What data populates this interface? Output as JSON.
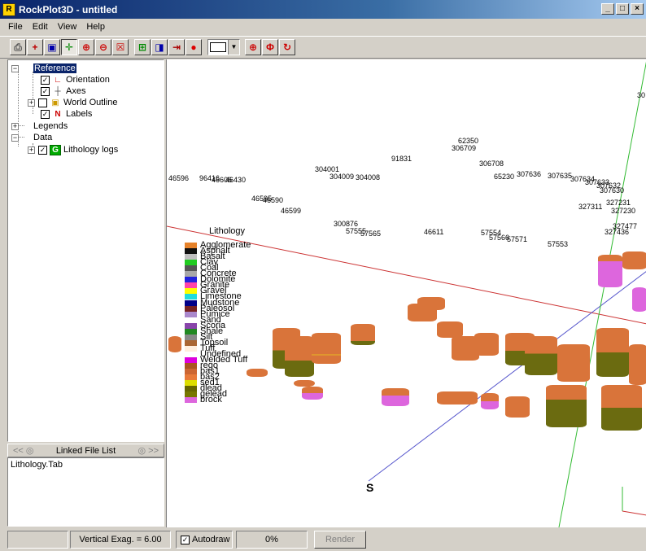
{
  "window": {
    "title": "RockPlot3D - untitled",
    "app_icon_glyph": "R",
    "controls": [
      "_",
      "□",
      "×"
    ]
  },
  "menu": [
    "File",
    "Edit",
    "View",
    "Help"
  ],
  "toolbar": {
    "icons": [
      "printer-icon",
      "save-icon",
      "open-icon",
      "axis-icon",
      "zoom-in-icon",
      "zoom-out-icon",
      "zoom-extents-icon",
      "pan-icon",
      "rotate-icon",
      "move-icon",
      "light-icon"
    ],
    "glyphs": [
      "⎙",
      "+",
      "▣",
      "✛",
      "⊕",
      "⊖",
      "☒",
      "⊞",
      "◨",
      "⇥",
      "●"
    ],
    "rotation_glyphs": [
      "⊕",
      "Φ",
      "↻"
    ]
  },
  "tree": {
    "reference": "Reference",
    "orientation": "Orientation",
    "axes": "Axes",
    "world_outline": "World Outline",
    "labels": "Labels",
    "legends": "Legends",
    "data": "Data",
    "lithology_logs": "Lithology logs"
  },
  "linked_file": {
    "header": "Linked File List",
    "left_arrows": "<<",
    "right_arrows": ">>",
    "items": [
      "Lithology.Tab"
    ]
  },
  "legend": {
    "title": "Lithology",
    "items": [
      {
        "name": "Agglomerate",
        "color": "#e6822a"
      },
      {
        "name": "Asphalt",
        "color": "#111111"
      },
      {
        "name": "Basalt",
        "color": "#c0c0c0"
      },
      {
        "name": "Clay",
        "color": "#22cc22"
      },
      {
        "name": "Coal",
        "color": "#555555"
      },
      {
        "name": "Concrete",
        "color": "#a8a8a8"
      },
      {
        "name": "Dolomite",
        "color": "#2222dd"
      },
      {
        "name": "Granite",
        "color": "#ff44aa"
      },
      {
        "name": "Gravel",
        "color": "#ffff00"
      },
      {
        "name": "Limestone",
        "color": "#22dddd"
      },
      {
        "name": "Mudstone",
        "color": "#000088"
      },
      {
        "name": "Paleosol",
        "color": "#772222"
      },
      {
        "name": "Pumice",
        "color": "#aa88cc"
      },
      {
        "name": "Sand",
        "color": "#ffffff"
      },
      {
        "name": "Scoria",
        "color": "#8844aa"
      },
      {
        "name": "Shale",
        "color": "#228822"
      },
      {
        "name": "Silt",
        "color": "#888888"
      },
      {
        "name": "Topsoil",
        "color": "#aa6633"
      },
      {
        "name": "Tuff",
        "color": "#ffeedd"
      },
      {
        "name": "Undefined",
        "color": "#ffffff"
      },
      {
        "name": "Welded Tuff",
        "color": "#dd00dd"
      },
      {
        "name": "rego",
        "color": "#aa5522"
      },
      {
        "name": "bas1",
        "color": "#cc6633"
      },
      {
        "name": "bas2",
        "color": "#e87a3a"
      },
      {
        "name": "sed1",
        "color": "#dddd00"
      },
      {
        "name": "dlead",
        "color": "#666600"
      },
      {
        "name": "gelead",
        "color": "#777700"
      },
      {
        "name": "brock",
        "color": "#dd66dd"
      }
    ]
  },
  "well_labels": [
    "62350",
    "306709",
    "91831",
    "306708",
    "304001",
    "304009",
    "304008",
    "46596",
    "96416",
    "46606",
    "46430",
    "65230",
    "307636",
    "307635",
    "307634",
    "307633",
    "307632",
    "307630",
    "46595",
    "46590",
    "46599",
    "327311",
    "327231",
    "327230",
    "300876",
    "57555",
    "57565",
    "46611",
    "57554",
    "57566",
    "57571",
    "327477",
    "327436",
    "57553",
    "30"
  ],
  "compass_label": "S",
  "status": {
    "vertical_exag": "Vertical Exag. = 6.00",
    "autodraw": "Autodraw",
    "autodraw_checked": true,
    "progress": "0%",
    "render": "Render"
  },
  "colors": {
    "cyl_orange": "#d9743a",
    "cyl_olive": "#6b6b10",
    "cyl_pink": "#dd66dd",
    "axis_red": "#cc3333",
    "axis_blue": "#5555cc",
    "axis_green": "#33bb33"
  }
}
